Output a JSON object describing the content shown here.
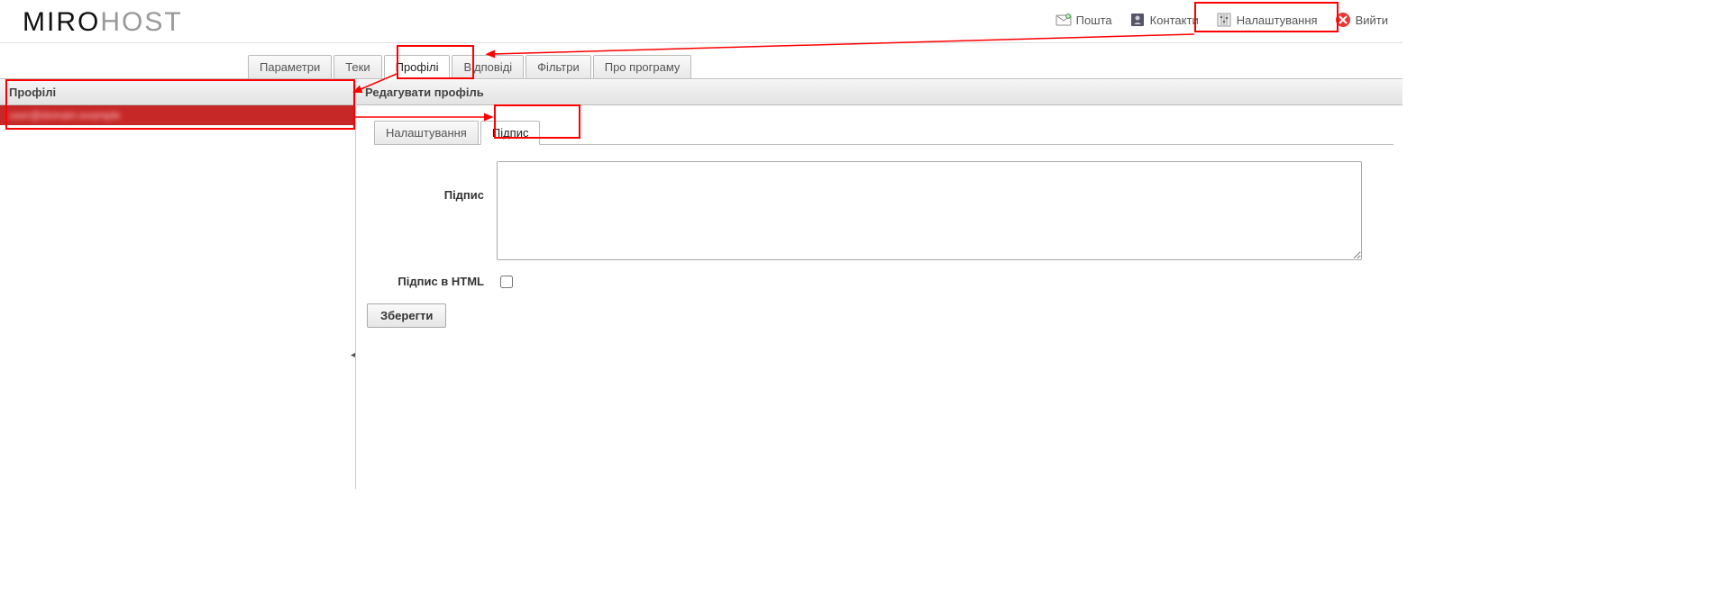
{
  "logo": {
    "part1": "MIRO",
    "part2": "HOST"
  },
  "topnav": {
    "mail": {
      "label": "Пошта"
    },
    "contacts": {
      "label": "Контакти"
    },
    "settings": {
      "label": "Налаштування"
    },
    "logout": {
      "label": "Вийти"
    }
  },
  "mainTabs": {
    "params": {
      "label": "Параметри"
    },
    "folders": {
      "label": "Теки"
    },
    "profiles": {
      "label": "Профілі"
    },
    "replies": {
      "label": "Відповіді"
    },
    "filters": {
      "label": "Фільтри"
    },
    "about": {
      "label": "Про програму"
    }
  },
  "sidebar": {
    "heading": "Профілі",
    "items": [
      {
        "label": "user@domain.example"
      }
    ]
  },
  "mainPanel": {
    "heading": "Редагувати профіль",
    "innerTabs": {
      "settings": {
        "label": "Налаштування"
      },
      "signature": {
        "label": "Підпис"
      }
    },
    "form": {
      "signatureLabel": "Підпис",
      "signatureValue": "",
      "htmlSigLabel": "Підпис в HTML",
      "htmlSigChecked": false,
      "saveButton": "Зберегти"
    }
  },
  "colors": {
    "annotation": "#ff0000",
    "selectedRow": "#c62828"
  }
}
